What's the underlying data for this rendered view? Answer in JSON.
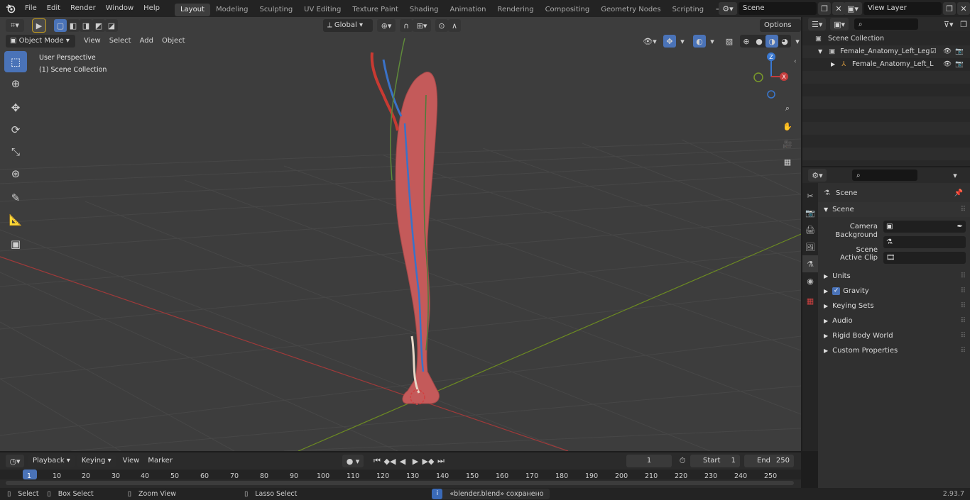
{
  "menu": [
    "File",
    "Edit",
    "Render",
    "Window",
    "Help"
  ],
  "workspaces": [
    "Layout",
    "Modeling",
    "Sculpting",
    "UV Editing",
    "Texture Paint",
    "Shading",
    "Animation",
    "Rendering",
    "Compositing",
    "Geometry Nodes",
    "Scripting"
  ],
  "active_workspace": "Layout",
  "scene_name": "Scene",
  "view_layer": "View Layer",
  "viewport": {
    "mode": "Object Mode",
    "menus": [
      "View",
      "Select",
      "Add",
      "Object"
    ],
    "transform_orientation": "Global",
    "options_label": "Options",
    "perspective_label": "User Perspective",
    "collection_label": "(1) Scene Collection"
  },
  "gizmo": {
    "z": "Z",
    "x": "X",
    "y": "Y"
  },
  "outliner": {
    "root": "Scene Collection",
    "collection": "Female_Anatomy_Left_Leg",
    "object": "Female_Anatomy_Left_L"
  },
  "properties": {
    "context": "Scene",
    "panel_title": "Scene",
    "fields": [
      {
        "label": "Camera"
      },
      {
        "label": "Background Scene"
      },
      {
        "label": "Active Clip"
      }
    ],
    "subpanels": [
      "Units",
      "Gravity",
      "Keying Sets",
      "Audio",
      "Rigid Body World",
      "Custom Properties"
    ]
  },
  "timeline": {
    "menus": [
      "Playback",
      "Keying",
      "View",
      "Marker"
    ],
    "current_frame": "1",
    "start_label": "Start",
    "start": "1",
    "end_label": "End",
    "end": "250",
    "ticks": [
      "1",
      "10",
      "20",
      "30",
      "40",
      "50",
      "60",
      "70",
      "80",
      "90",
      "100",
      "110",
      "120",
      "130",
      "140",
      "150",
      "160",
      "170",
      "180",
      "190",
      "200",
      "210",
      "220",
      "230",
      "240",
      "250"
    ]
  },
  "status": {
    "select": "Select",
    "box_select": "Box Select",
    "zoom_view": "Zoom View",
    "lasso_select": "Lasso Select",
    "message": "«blender.blend» сохранено",
    "version": "2.93.7"
  },
  "colors": {
    "accent": "#4a73b8",
    "x_axis": "#c43c3c",
    "y_axis": "#7a9a2a",
    "z_axis": "#3a78d0"
  }
}
